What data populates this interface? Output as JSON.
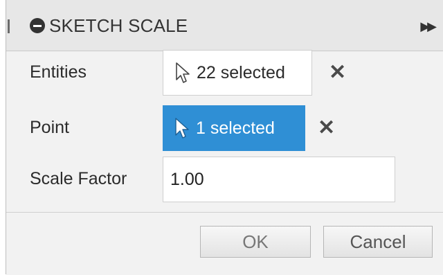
{
  "dialog": {
    "title": "SKETCH SCALE",
    "icons": {
      "title": "minus-circle-icon",
      "expand": "double-chevron-right-icon",
      "cursor": "arrow-cursor-icon",
      "clear": "x-icon"
    }
  },
  "fields": {
    "entities": {
      "label": "Entities",
      "value": "22 selected"
    },
    "point": {
      "label": "Point",
      "value": "1 selected"
    },
    "scale_factor": {
      "label": "Scale Factor",
      "value": "1.00"
    }
  },
  "buttons": {
    "ok": "OK",
    "cancel": "Cancel"
  },
  "colors": {
    "active_selection": "#2f8fd5"
  }
}
